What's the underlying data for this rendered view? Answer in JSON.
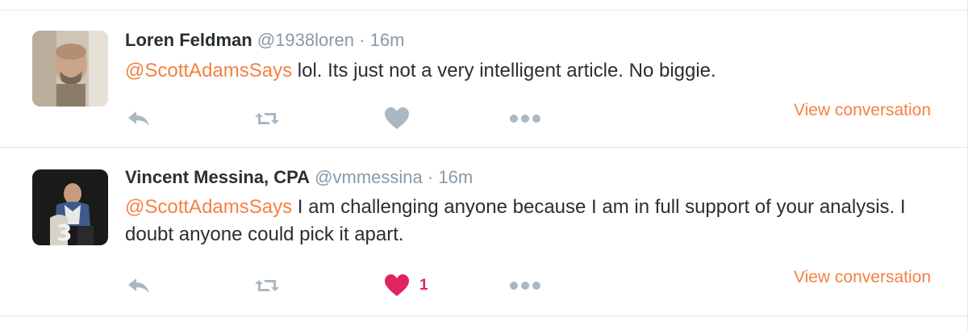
{
  "colors": {
    "link": "#f58142",
    "muted": "#8899a6",
    "text": "#292f33",
    "liked": "#e0245e",
    "icon": "#aab8c2"
  },
  "tweets": [
    {
      "fullname": "Loren Feldman",
      "handle": "@1938loren",
      "separator": "·",
      "time": "16m",
      "mention": "@ScottAdamsSays",
      "text": " lol. Its just not a very intelligent article. No biggie.",
      "like_count": "",
      "liked": false,
      "view_conversation": "View conversation",
      "icons": {
        "reply": "reply-icon",
        "retweet": "retweet-icon",
        "like": "heart-icon",
        "more": "more-dots-icon"
      }
    },
    {
      "fullname": "Vincent Messina, CPA",
      "handle": "@vmmessina",
      "separator": "·",
      "time": "16m",
      "mention": "@ScottAdamsSays",
      "text": " I am challenging anyone because I am in full support of your analysis. I doubt anyone could pick it apart.",
      "like_count": "1",
      "liked": true,
      "view_conversation": "View conversation",
      "icons": {
        "reply": "reply-icon",
        "retweet": "retweet-icon",
        "like": "heart-icon",
        "more": "more-dots-icon"
      }
    }
  ]
}
